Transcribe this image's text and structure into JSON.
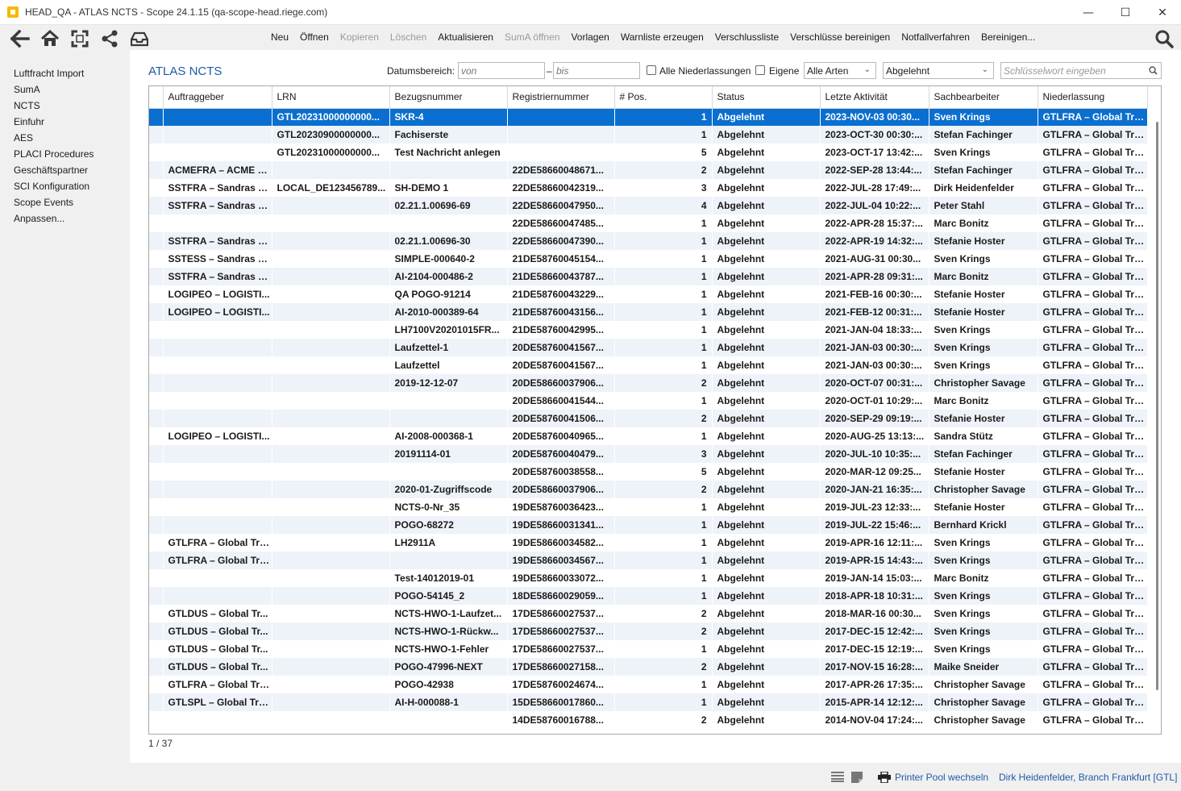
{
  "window": {
    "title": "HEAD_QA - ATLAS NCTS - Scope 24.1.15 (qa-scope-head.riege.com)",
    "minimize": "—",
    "maximize": "☐",
    "close": "✕"
  },
  "toolbar": {
    "menu": [
      {
        "label": "Neu",
        "enabled": true
      },
      {
        "label": "Öffnen",
        "enabled": true
      },
      {
        "label": "Kopieren",
        "enabled": false
      },
      {
        "label": "Löschen",
        "enabled": false
      },
      {
        "label": "Aktualisieren",
        "enabled": true
      },
      {
        "label": "SumA öffnen",
        "enabled": false
      },
      {
        "label": "Vorlagen",
        "enabled": true
      },
      {
        "label": "Warnliste erzeugen",
        "enabled": true
      },
      {
        "label": "Verschlussliste",
        "enabled": true
      },
      {
        "label": "Verschlüsse bereinigen",
        "enabled": true
      },
      {
        "label": "Notfallverfahren",
        "enabled": true
      },
      {
        "label": "Bereinigen...",
        "enabled": true
      }
    ]
  },
  "sidebar": {
    "items": [
      {
        "label": "Luftfracht Import"
      },
      {
        "label": "SumA"
      },
      {
        "label": "NCTS"
      },
      {
        "label": "Einfuhr"
      },
      {
        "label": "AES"
      },
      {
        "label": "PLACI Procedures"
      },
      {
        "label": "Geschäftspartner"
      },
      {
        "label": "SCI Konfiguration"
      },
      {
        "label": "Scope Events"
      },
      {
        "label": "Anpassen..."
      }
    ]
  },
  "main": {
    "title": "ATLAS NCTS",
    "filters": {
      "date_label": "Datumsbereich:",
      "from_placeholder": "von",
      "dash": "–",
      "to_placeholder": "bis",
      "all_branches_label": "Alle Niederlassungen",
      "own_label": "Eigene",
      "type_select": "Alle Arten",
      "status_select": "Abgelehnt",
      "keyword_placeholder": "Schlüsselwort eingeben"
    },
    "table": {
      "columns": [
        "Auftraggeber",
        "LRN",
        "Bezugsnummer",
        "Registriernummer",
        "# Pos.",
        "Status",
        "Letzte Aktivität",
        "Sachbearbeiter",
        "Niederlassung"
      ],
      "rows": [
        [
          "",
          "GTL20231000000000...",
          "SKR-4",
          "",
          "1",
          "Abgelehnt",
          "2023-NOV-03 00:30...",
          "Sven Krings",
          "GTLFRA – Global Tra..."
        ],
        [
          "",
          "GTL20230900000000...",
          "Fachiserste",
          "",
          "1",
          "Abgelehnt",
          "2023-OCT-30 00:30:...",
          "Stefan Fachinger",
          "GTLFRA – Global Tra..."
        ],
        [
          "",
          "GTL20231000000000...",
          "Test Nachricht anlegen",
          "",
          "5",
          "Abgelehnt",
          "2023-OCT-17 13:42:...",
          "Sven Krings",
          "GTLFRA – Global Tra..."
        ],
        [
          "ACMEFRA – ACME Fr...",
          "",
          "",
          "22DE58660048671...",
          "2",
          "Abgelehnt",
          "2022-SEP-28 13:44:...",
          "Stefan Fachinger",
          "GTLFRA – Global Tra..."
        ],
        [
          "SSTFRA – Sandras gr...",
          "LOCAL_DE123456789...",
          "SH-DEMO 1",
          "22DE58660042319...",
          "3",
          "Abgelehnt",
          "2022-JUL-28 17:49:...",
          "Dirk Heidenfelder",
          "GTLFRA – Global Tra..."
        ],
        [
          "SSTFRA – Sandras gr...",
          "",
          "02.21.1.00696-69",
          "22DE58660047950...",
          "4",
          "Abgelehnt",
          "2022-JUL-04 10:22:...",
          "Peter Stahl",
          "GTLFRA – Global Tra..."
        ],
        [
          "",
          "",
          "",
          "22DE58660047485...",
          "1",
          "Abgelehnt",
          "2022-APR-28 15:37:...",
          "Marc Bonitz",
          "GTLFRA – Global Tra..."
        ],
        [
          "SSTFRA – Sandras gr...",
          "",
          "02.21.1.00696-30",
          "22DE58660047390...",
          "1",
          "Abgelehnt",
          "2022-APR-19 14:32:...",
          "Stefanie Hoster",
          "GTLFRA – Global Tra..."
        ],
        [
          "SSTESS – Sandras kl...",
          "",
          "SIMPLE-000640-2",
          "21DE58760045154...",
          "1",
          "Abgelehnt",
          "2021-AUG-31 00:30...",
          "Sven Krings",
          "GTLFRA – Global Tra..."
        ],
        [
          "SSTFRA – Sandras gr...",
          "",
          "AI-2104-000486-2",
          "21DE58660043787...",
          "1",
          "Abgelehnt",
          "2021-APR-28 09:31:...",
          "Marc Bonitz",
          "GTLFRA – Global Tra..."
        ],
        [
          "LOGIPEO – LOGISTI...",
          "",
          "QA POGO-91214",
          "21DE58760043229...",
          "1",
          "Abgelehnt",
          "2021-FEB-16 00:30:...",
          "Stefanie Hoster",
          "GTLFRA – Global Tra..."
        ],
        [
          "LOGIPEO – LOGISTI...",
          "",
          "AI-2010-000389-64",
          "21DE58760043156...",
          "1",
          "Abgelehnt",
          "2021-FEB-12 00:31:...",
          "Stefanie Hoster",
          "GTLFRA – Global Tra..."
        ],
        [
          "",
          "",
          "LH7100V20201015FR...",
          "21DE58760042995...",
          "1",
          "Abgelehnt",
          "2021-JAN-04 18:33:...",
          "Sven Krings",
          "GTLFRA – Global Tra..."
        ],
        [
          "",
          "",
          "Laufzettel-1",
          "20DE58760041567...",
          "1",
          "Abgelehnt",
          "2021-JAN-03 00:30:...",
          "Sven Krings",
          "GTLFRA – Global Tra..."
        ],
        [
          "",
          "",
          "Laufzettel",
          "20DE58760041567...",
          "1",
          "Abgelehnt",
          "2021-JAN-03 00:30:...",
          "Sven Krings",
          "GTLFRA – Global Tra..."
        ],
        [
          "",
          "",
          "2019-12-12-07",
          "20DE58660037906...",
          "2",
          "Abgelehnt",
          "2020-OCT-07 00:31:...",
          "Christopher Savage",
          "GTLFRA – Global Tra..."
        ],
        [
          "",
          "",
          "",
          "20DE58660041544...",
          "1",
          "Abgelehnt",
          "2020-OCT-01 10:29:...",
          "Marc Bonitz",
          "GTLFRA – Global Tra..."
        ],
        [
          "",
          "",
          "",
          "20DE58760041506...",
          "2",
          "Abgelehnt",
          "2020-SEP-29 09:19:...",
          "Stefanie Hoster",
          "GTLFRA – Global Tra..."
        ],
        [
          "LOGIPEO – LOGISTI...",
          "",
          "AI-2008-000368-1",
          "20DE58760040965...",
          "1",
          "Abgelehnt",
          "2020-AUG-25 13:13:...",
          "Sandra Stütz",
          "GTLFRA – Global Tra..."
        ],
        [
          "",
          "",
          "20191114-01",
          "20DE58760040479...",
          "3",
          "Abgelehnt",
          "2020-JUL-10 10:35:...",
          "Stefan Fachinger",
          "GTLFRA – Global Tra..."
        ],
        [
          "",
          "",
          "",
          "20DE58760038558...",
          "5",
          "Abgelehnt",
          "2020-MAR-12 09:25...",
          "Stefanie Hoster",
          "GTLFRA – Global Tra..."
        ],
        [
          "",
          "",
          "2020-01-Zugriffscode",
          "20DE58660037906...",
          "2",
          "Abgelehnt",
          "2020-JAN-21 16:35:...",
          "Christopher Savage",
          "GTLFRA – Global Tra..."
        ],
        [
          "",
          "",
          "NCTS-0-Nr_35",
          "19DE58760036423...",
          "1",
          "Abgelehnt",
          "2019-JUL-23 12:33:...",
          "Stefanie Hoster",
          "GTLFRA – Global Tra..."
        ],
        [
          "",
          "",
          "POGO-68272",
          "19DE58660031341...",
          "1",
          "Abgelehnt",
          "2019-JUL-22 15:46:...",
          "Bernhard Krickl",
          "GTLFRA – Global Tra..."
        ],
        [
          "GTLFRA – Global Tra...",
          "",
          "LH2911A",
          "19DE58660034582...",
          "1",
          "Abgelehnt",
          "2019-APR-16 12:11:...",
          "Sven Krings",
          "GTLFRA – Global Tra..."
        ],
        [
          "GTLFRA – Global Tra...",
          "",
          "",
          "19DE58660034567...",
          "1",
          "Abgelehnt",
          "2019-APR-15 14:43:...",
          "Sven Krings",
          "GTLFRA – Global Tra..."
        ],
        [
          "",
          "",
          "Test-14012019-01",
          "19DE58660033072...",
          "1",
          "Abgelehnt",
          "2019-JAN-14 15:03:...",
          "Marc Bonitz",
          "GTLFRA – Global Tra..."
        ],
        [
          "",
          "",
          "POGO-54145_2",
          "18DE58660029059...",
          "1",
          "Abgelehnt",
          "2018-APR-18 10:31:...",
          "Sven Krings",
          "GTLFRA – Global Tra..."
        ],
        [
          "GTLDUS – Global Tr...",
          "",
          "NCTS-HWO-1-Laufzet...",
          "17DE58660027537...",
          "2",
          "Abgelehnt",
          "2018-MAR-16 00:30...",
          "Sven Krings",
          "GTLFRA – Global Tra..."
        ],
        [
          "GTLDUS – Global Tr...",
          "",
          "NCTS-HWO-1-Rückw...",
          "17DE58660027537...",
          "2",
          "Abgelehnt",
          "2017-DEC-15 12:42:...",
          "Sven Krings",
          "GTLFRA – Global Tra..."
        ],
        [
          "GTLDUS – Global Tr...",
          "",
          "NCTS-HWO-1-Fehler",
          "17DE58660027537...",
          "1",
          "Abgelehnt",
          "2017-DEC-15 12:19:...",
          "Sven Krings",
          "GTLFRA – Global Tra..."
        ],
        [
          "GTLDUS – Global Tr...",
          "",
          "POGO-47996-NEXT",
          "17DE58660027158...",
          "2",
          "Abgelehnt",
          "2017-NOV-15 16:28:...",
          "Maike Sneider",
          "GTLFRA – Global Tra..."
        ],
        [
          "GTLFRA – Global Tra...",
          "",
          "POGO-42938",
          "17DE58760024674...",
          "1",
          "Abgelehnt",
          "2017-APR-26 17:35:...",
          "Christopher Savage",
          "GTLFRA – Global Tra..."
        ],
        [
          "GTLSPL – Global Tra...",
          "",
          "AI-H-000088-1",
          "15DE58660017860...",
          "1",
          "Abgelehnt",
          "2015-APR-14 12:12:...",
          "Christopher Savage",
          "GTLFRA – Global Tra..."
        ],
        [
          "",
          "",
          "",
          "14DE58760016788...",
          "2",
          "Abgelehnt",
          "2014-NOV-04 17:24:...",
          "Christopher Savage",
          "GTLFRA – Global Tra..."
        ]
      ],
      "selected_row": 0
    },
    "count": "1 / 37"
  },
  "statusbar": {
    "printer_pool": "Printer Pool wechseln",
    "user": "Dirk Heidenfelder, Branch Frankfurt [GTL]"
  },
  "colors": {
    "accent": "#1f5aa6",
    "selected_row": "#0a6fd0",
    "alt_row": "#eef3f9"
  }
}
